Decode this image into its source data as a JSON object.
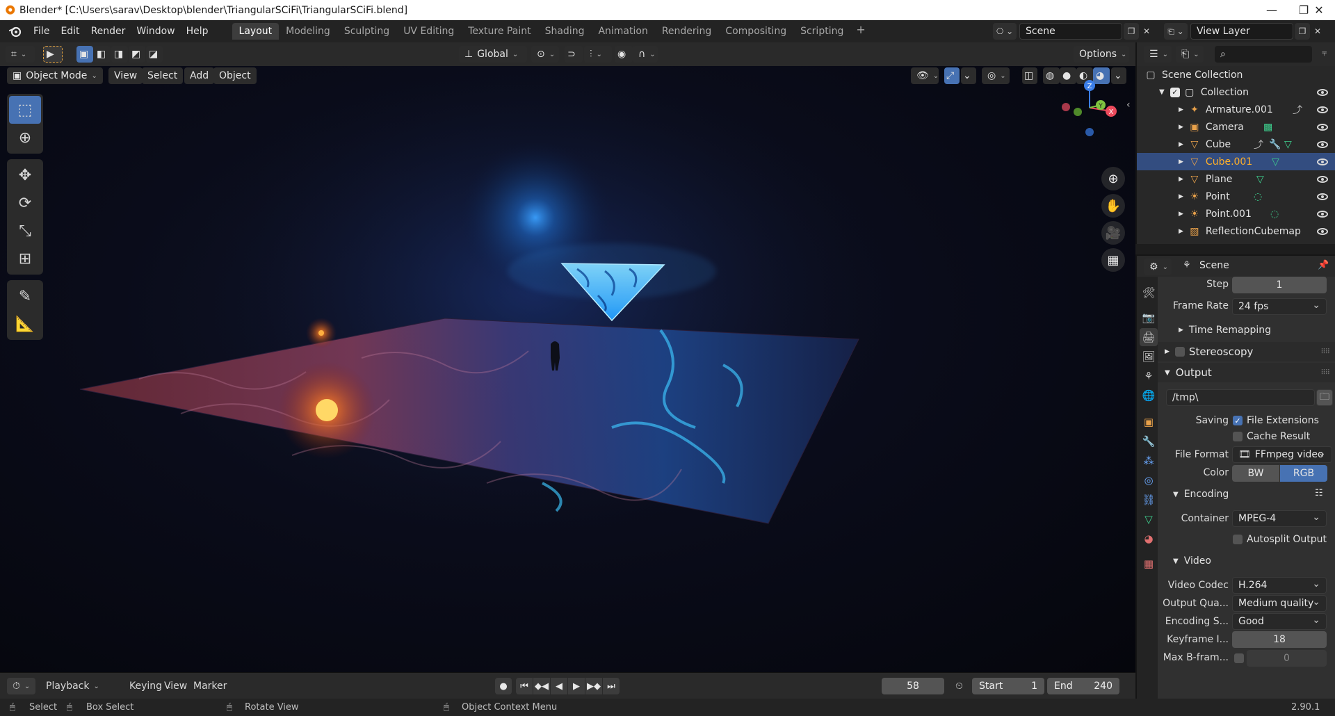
{
  "window": {
    "title": "Blender* [C:\\Users\\sarav\\Desktop\\blender\\TriangularSCiFi\\TriangularSCiFi.blend]",
    "minimize": "—",
    "maximize": "❐",
    "close": "✕"
  },
  "menu": [
    "File",
    "Edit",
    "Render",
    "Window",
    "Help"
  ],
  "workspaces": [
    "Layout",
    "Modeling",
    "Sculpting",
    "UV Editing",
    "Texture Paint",
    "Shading",
    "Animation",
    "Rendering",
    "Compositing",
    "Scripting"
  ],
  "active_workspace": "Layout",
  "scene_name": "Scene",
  "view_layer": "View Layer",
  "viewport": {
    "transform_orientation": "Global",
    "options_label": "Options",
    "mode": "Object Mode",
    "header_menus": [
      "View",
      "Select",
      "Add",
      "Object"
    ],
    "gizmo_axes": {
      "x": "X",
      "y": "Y",
      "z": "Z"
    }
  },
  "outliner": {
    "root": "Scene Collection",
    "collection": "Collection",
    "items": [
      {
        "name": "Armature.001",
        "icon": "armature-icon",
        "color": "#e8a14a"
      },
      {
        "name": "Camera",
        "icon": "camera-icon",
        "color": "#e8a14a"
      },
      {
        "name": "Cube",
        "icon": "mesh-icon",
        "color": "#e8a14a"
      },
      {
        "name": "Cube.001",
        "icon": "mesh-icon",
        "color": "#e8a14a",
        "selected": true
      },
      {
        "name": "Plane",
        "icon": "mesh-icon",
        "color": "#e8a14a"
      },
      {
        "name": "Point",
        "icon": "light-icon",
        "color": "#e8a14a"
      },
      {
        "name": "Point.001",
        "icon": "light-icon",
        "color": "#e8a14a"
      },
      {
        "name": "ReflectionCubemap",
        "icon": "probe-icon",
        "color": "#e8a14a"
      }
    ]
  },
  "properties": {
    "context": "Scene",
    "step_label": "Step",
    "step_value": "1",
    "frame_rate_label": "Frame Rate",
    "frame_rate_value": "24 fps",
    "time_remapping": "Time Remapping",
    "stereoscopy": "Stereoscopy",
    "output_section": "Output",
    "output_path": "/tmp\\",
    "saving_label": "Saving",
    "file_extensions": "File Extensions",
    "cache_result": "Cache Result",
    "file_format_label": "File Format",
    "file_format_value": "FFmpeg video",
    "color_label": "Color",
    "color_bw": "BW",
    "color_rgb": "RGB",
    "encoding_section": "Encoding",
    "container_label": "Container",
    "container_value": "MPEG-4",
    "autosplit": "Autosplit Output",
    "video_section": "Video",
    "video_codec_label": "Video Codec",
    "video_codec_value": "H.264",
    "output_quality_label": "Output Qua...",
    "output_quality_value": "Medium quality",
    "encoding_speed_label": "Encoding S...",
    "encoding_speed_value": "Good",
    "keyframe_label": "Keyframe I...",
    "keyframe_value": "18",
    "max_bframes_label": "Max B-fram...",
    "max_bframes_value": "0"
  },
  "timeline": {
    "menus": [
      "Playback",
      "Keying",
      "View",
      "Marker"
    ],
    "current_frame": "58",
    "start_label": "Start",
    "start_value": "1",
    "end_label": "End",
    "end_value": "240"
  },
  "statusbar": {
    "select": "Select",
    "box_select": "Box Select",
    "rotate_view": "Rotate View",
    "context_menu": "Object Context Menu",
    "version": "2.90.1"
  },
  "colors": {
    "accent_blue": "#4772b3",
    "selection_orange": "#ffaf29",
    "object_orange": "#e8a14a",
    "data_green": "#3ecf8e"
  }
}
